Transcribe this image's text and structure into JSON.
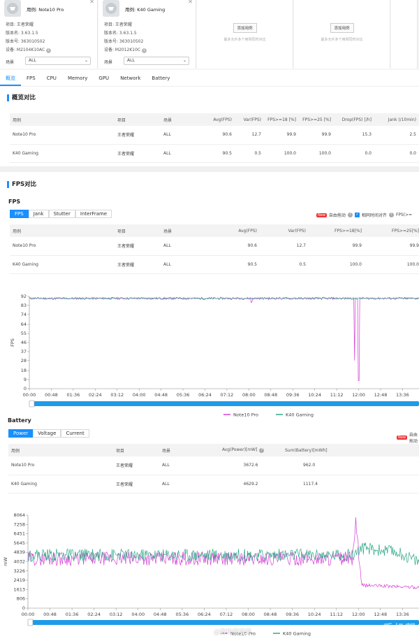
{
  "devices": [
    {
      "name": "用例: Note10 Pro",
      "project": "项目: 王者荣耀",
      "version": "版本名: 3.63.1.5",
      "build": "版本号: 363010502",
      "device": "设备: M2104K10AC",
      "scene_label": "场景",
      "scene_value": "ALL"
    },
    {
      "name": "用例: K40 Gaming",
      "project": "项目: 王者荣耀",
      "version": "版本名: 3.63.1.5",
      "build": "版本号: 363010502",
      "device": "设备: M2012K10C",
      "scene_label": "场景",
      "scene_value": "ALL"
    }
  ],
  "add_slots": [
    {
      "button": "添加用例",
      "hint": "最多允许多个用例同时对比"
    },
    {
      "button": "添加用例",
      "hint": "最多允许多个用例同时对比"
    }
  ],
  "tabs": [
    "概览",
    "FPS",
    "CPU",
    "Memory",
    "GPU",
    "Network",
    "Battery"
  ],
  "overview": {
    "title": "概览对比",
    "headers": [
      "用例",
      "项目",
      "场景",
      "Avg(FPS)",
      "Var(FPS)",
      "FPS>=18 [%]",
      "FPS>=25 [%]",
      "Drop(FPS) [/h]",
      "Jank (/10min)"
    ],
    "rows": [
      [
        "Note10 Pro",
        "王者荣耀",
        "ALL",
        "90.6",
        "12.7",
        "99.9",
        "99.9",
        "15.3",
        "2.5"
      ],
      [
        "K40 Gaming",
        "王者荣耀",
        "ALL",
        "90.5",
        "0.5",
        "100.0",
        "100.0",
        "0.0",
        "0.0"
      ]
    ]
  },
  "fps_section": {
    "title": "FPS对比",
    "subtitle": "FPS",
    "buttons": [
      "FPS",
      "Jank",
      "Stutter",
      "InterFrame"
    ],
    "new_badge": "New",
    "auto_drag": "自由拖动",
    "relative_time": "相同时间对齐",
    "fps_trunc": "FPS(>=",
    "headers": [
      "用例",
      "项目",
      "场景",
      "Avg(FPS)",
      "Var(FPS)",
      "FPS>=18[%]",
      "FPS>=25[%]"
    ],
    "rows": [
      [
        "Note10 Pro",
        "王者荣耀",
        "ALL",
        "90.6",
        "12.7",
        "99.9",
        "99.9"
      ],
      [
        "K40 Gaming",
        "王者荣耀",
        "ALL",
        "90.5",
        "0.5",
        "100.0",
        "100.0"
      ]
    ]
  },
  "battery_section": {
    "title": "Battery",
    "buttons": [
      "Power",
      "Voltage",
      "Current"
    ],
    "new_badge": "New",
    "auto_drag": "自由拖动",
    "headers": [
      "用例",
      "项目",
      "场景",
      "Avg(Power)[mW]",
      "Sum(Battery)[mWh]"
    ],
    "rows": [
      [
        "Note10 Pro",
        "王者荣耀",
        "ALL",
        "3672.6",
        "962.0"
      ],
      [
        "K40 Gaming",
        "王者荣耀",
        "ALL",
        "4629.2",
        "1117.4"
      ]
    ]
  },
  "chart_data": [
    {
      "type": "line",
      "ylabel": "FPS",
      "yticks": [
        0,
        9,
        18,
        28,
        37,
        46,
        55,
        64,
        74,
        83,
        92
      ],
      "ylim": [
        0,
        92
      ],
      "xticks": [
        "00:00",
        "00:48",
        "01:36",
        "02:24",
        "03:12",
        "04:00",
        "04:48",
        "05:36",
        "06:24",
        "07:12",
        "08:00",
        "08:48",
        "09:36",
        "10:24",
        "11:12",
        "12:00",
        "12:48",
        "13:36"
      ],
      "grid": false,
      "legend": "bottom",
      "series": [
        {
          "name": "Note10 Pro",
          "color": "#d63fd6",
          "base": 90,
          "noise": 1.2,
          "spikes": [
            [
              11.85,
              28
            ],
            [
              12.0,
              8
            ],
            [
              8.1,
              86
            ]
          ]
        },
        {
          "name": "K40 Gaming",
          "color": "#2fa888",
          "base": 90,
          "noise": 0.6,
          "spikes": []
        }
      ]
    },
    {
      "type": "line",
      "ylabel": "mW",
      "yticks": [
        0,
        806,
        1613,
        2419,
        3226,
        4032,
        4839,
        5645,
        6451,
        7258,
        8064
      ],
      "ylim": [
        0,
        8064
      ],
      "xticks": [
        "00:00",
        "00:48",
        "01:36",
        "02:24",
        "03:12",
        "04:00",
        "04:48",
        "05:36",
        "06:24",
        "07:12",
        "08:00",
        "08:48",
        "09:36",
        "10:24",
        "11:12",
        "12:00",
        "12:48",
        "13:36"
      ],
      "grid": false,
      "legend": "bottom",
      "series": [
        {
          "name": "Note10 Pro",
          "color": "#d63fd6",
          "segments": [
            [
              0,
              4300
            ],
            [
              11.8,
              4300
            ],
            [
              11.9,
              7800
            ],
            [
              12.1,
              2000
            ],
            [
              14.2,
              1800
            ]
          ],
          "noise": 600
        },
        {
          "name": "K40 Gaming",
          "color": "#2fa888",
          "segments": [
            [
              0,
              4600
            ],
            [
              11.8,
              4600
            ],
            [
              12.1,
              5200
            ],
            [
              13.5,
              4800
            ],
            [
              14.2,
              4000
            ]
          ],
          "noise": 550
        }
      ]
    }
  ],
  "watermark": {
    "text": "@数码侃侃侃",
    "logo": "手机帮",
    "logo_sub": "PHBANG"
  }
}
